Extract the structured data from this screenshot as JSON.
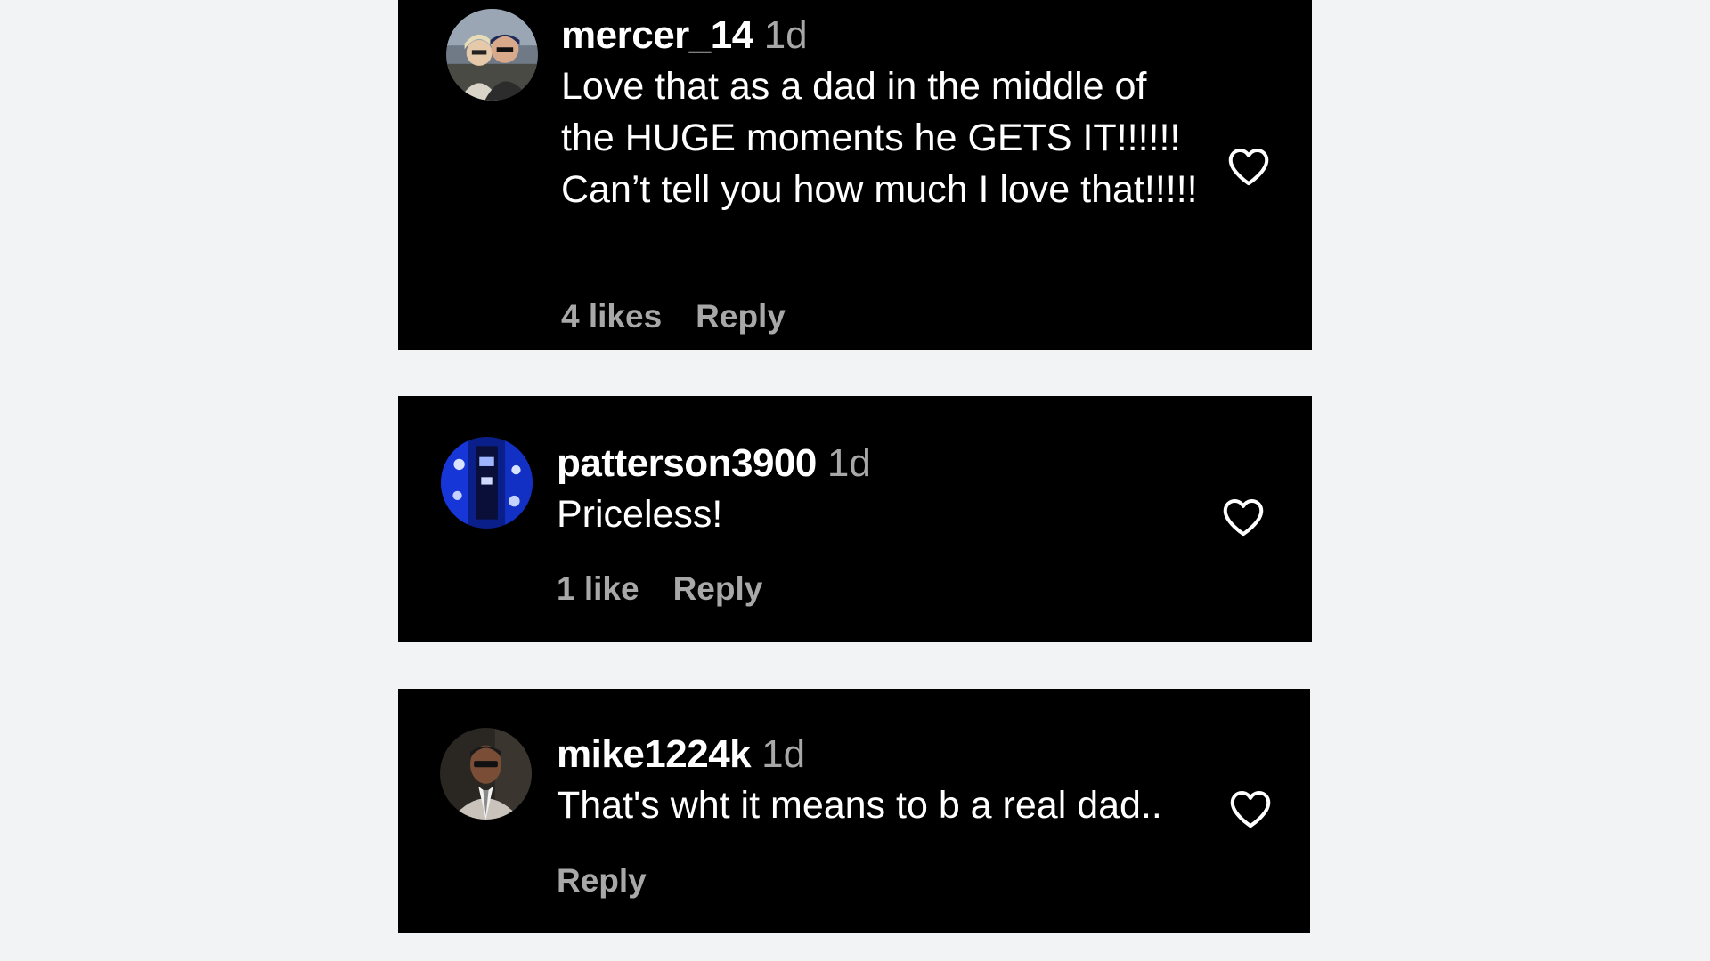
{
  "comments": [
    {
      "username": "mercer_14",
      "time": "1d",
      "text": "Love that as a dad in the middle of the HUGE moments he GETS IT!!!!!! Can’t tell you how much I love that!!!!!",
      "likes_label": "4 likes",
      "reply_label": "Reply",
      "avatar_icon": "two-people-photo-avatar",
      "like_icon": "heart-outline-icon"
    },
    {
      "username": "patterson3900",
      "time": "1d",
      "text": "Priceless!",
      "likes_label": "1 like",
      "reply_label": "Reply",
      "avatar_icon": "blue-stadium-photo-avatar",
      "like_icon": "heart-outline-icon"
    },
    {
      "username": "mike1224k",
      "time": "1d",
      "text": "That's wht it means to b a real dad..",
      "likes_label": "",
      "reply_label": "Reply",
      "avatar_icon": "man-in-suit-photo-avatar",
      "like_icon": "heart-outline-icon"
    }
  ],
  "colors": {
    "page_background": "#f2f3f5",
    "card_background": "#000000",
    "primary_text": "#ffffff",
    "secondary_text": "#a8a8a8"
  }
}
